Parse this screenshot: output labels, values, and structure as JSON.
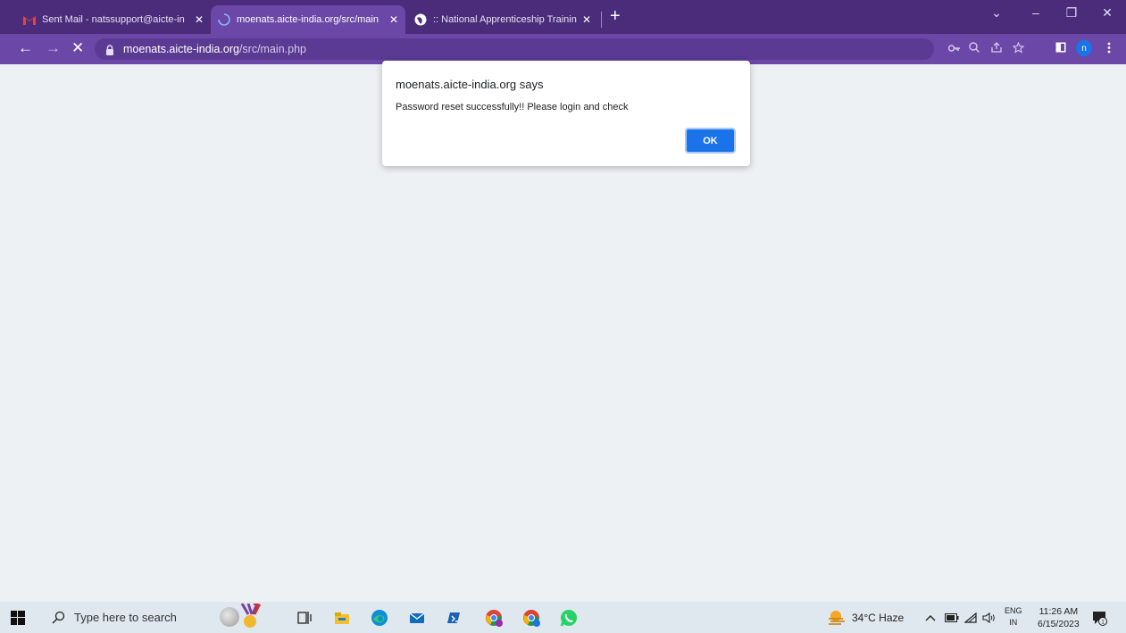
{
  "browser": {
    "tabs": [
      {
        "title": "Sent Mail - natssupport@aicte-in",
        "close": "✕",
        "icon": "gmail-icon",
        "active": false
      },
      {
        "title": "moenats.aicte-india.org/src/main",
        "close": "✕",
        "icon": "loading-spinner-icon",
        "active": true
      },
      {
        "title": ":: National Apprenticeship Trainin",
        "close": "✕",
        "icon": "globe-icon",
        "active": false
      }
    ],
    "new_tab": "+",
    "window_controls": {
      "dropdown": "⌄",
      "minimize": "–",
      "restore": "❐",
      "close": "✕"
    },
    "toolbar": {
      "back": "←",
      "forward": "→",
      "stop": "✕",
      "url_host": "moenats.aicte-india.org",
      "url_path": "/src/main.php",
      "profile_initial": "n"
    }
  },
  "dialog": {
    "title": "moenats.aicte-india.org says",
    "message": "Password reset successfully!! Please login and check",
    "ok_label": "OK"
  },
  "taskbar": {
    "search_placeholder": "Type here to search",
    "weather": "34°C  Haze",
    "language_top": "ENG",
    "language_bottom": "IN",
    "time": "11:26 AM",
    "date": "6/15/2023",
    "colors": {
      "accent": "#1a73e8",
      "tabstrip": "#4a2c7a",
      "toolbar": "#6b47a8"
    }
  }
}
